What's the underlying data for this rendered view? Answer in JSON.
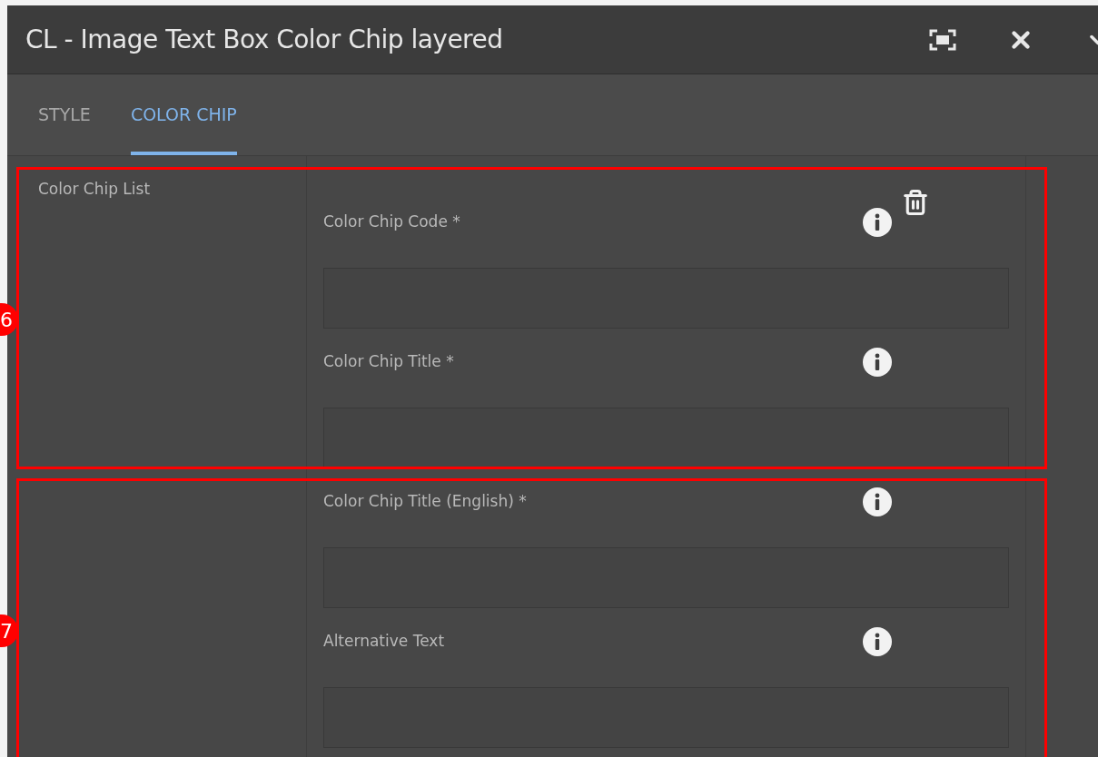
{
  "dialog": {
    "title": "CL - Image Text Box Color Chip layered"
  },
  "tabs": [
    {
      "label": "STYLE",
      "selected": false
    },
    {
      "label": "COLOR CHIP",
      "selected": true
    }
  ],
  "section": {
    "label": "Color Chip List"
  },
  "fields": [
    {
      "label": "Color Chip Code *",
      "deletable": true
    },
    {
      "label": "Color Chip Title *",
      "deletable": false
    },
    {
      "label": "Color Chip Title (English) *",
      "deletable": false
    },
    {
      "label": "Alternative Text",
      "deletable": false
    }
  ],
  "annotations": [
    {
      "number": "6"
    },
    {
      "number": "7"
    }
  ]
}
